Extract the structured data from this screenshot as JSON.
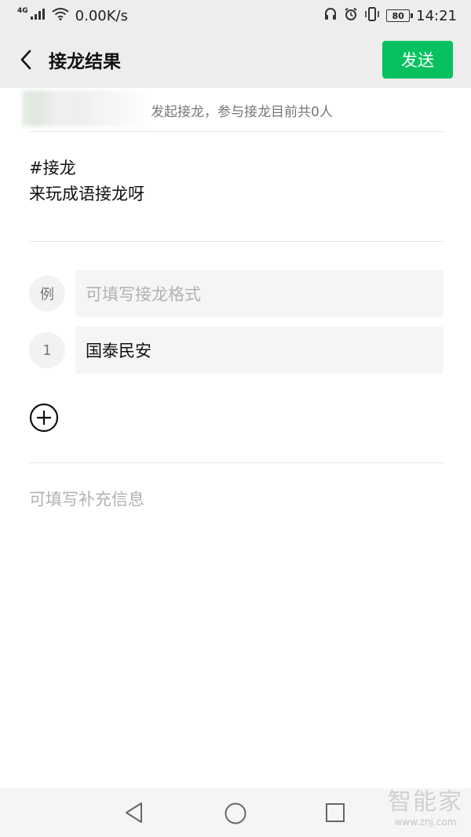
{
  "status_bar": {
    "network_type": "4G",
    "speed": "0.00K/s",
    "battery": "80",
    "time": "14:21",
    "icons": [
      "signal-icon",
      "wifi-icon",
      "headphones-icon",
      "alarm-icon",
      "vibrate-icon",
      "battery-icon"
    ]
  },
  "nav": {
    "back_icon": "chevron-left-icon",
    "title": "接龙结果",
    "send_label": "发送",
    "accent_color": "#07c160"
  },
  "initiator": {
    "text": "发起接龙，参与接龙目前共0人"
  },
  "topic": {
    "hashtag": "#接龙",
    "description": "来玩成语接龙呀"
  },
  "entries": [
    {
      "badge": "例",
      "value": "",
      "placeholder": "可填写接龙格式"
    },
    {
      "badge": "1",
      "value": "国泰民安",
      "placeholder": ""
    }
  ],
  "add_icon": "plus-circle-icon",
  "supplement": {
    "placeholder": "可填写补充信息"
  },
  "android_nav": {
    "icons": [
      "back-triangle-icon",
      "home-circle-icon",
      "recents-square-icon"
    ]
  },
  "watermark": {
    "main": "智能家",
    "sub": "www.znj.com"
  }
}
